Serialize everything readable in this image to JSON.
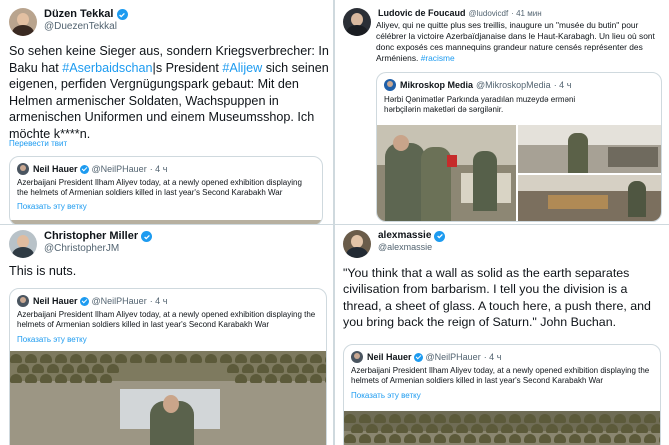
{
  "tweets": [
    {
      "name": "Düzen Tekkal",
      "handle": "@DuezenTekkal",
      "text_parts": [
        {
          "t": "So sehen keine Sieger aus, sondern Kriegsverbrecher: In Baku hat ",
          "tag": false
        },
        {
          "t": "#Aserbaidschan",
          "tag": true
        },
        {
          "t": "|s President ",
          "tag": false
        },
        {
          "t": "#Alijew",
          "tag": true
        },
        {
          "t": " sich seinen eigenen, perfiden Vergnügungspark gebaut: Mit den Helmen armenischer Soldaten, Wachspuppen in armenischen Uniformen und einem Museumsshop. Ich möchte k****n.",
          "tag": false
        }
      ],
      "translate": "Перевести твит",
      "quote": {
        "name": "Neil Hauer",
        "handle": "@NeilPHauer",
        "time": "· 4 ч",
        "text": "Azerbaijani President Ilham Aliyev today, at a newly opened exhibition displaying the helmets of Armenian soldiers killed in last year's Second Karabakh War",
        "show": "Показать эту ветку"
      }
    },
    {
      "name": "Ludovic de Foucaud",
      "handle": "@ludovicdf",
      "time": "· 41 мин",
      "text_parts": [
        {
          "t": "Aliyev, qui ne quitte plus ses treillis, inaugure un \"musée du butin\" pour célébrer la victoire Azerbaïdjanaise dans le Haut-Karabagh. Un lieu où sont donc exposés ces mannequins grandeur nature censés représenter des Arméniens. ",
          "tag": false
        },
        {
          "t": "#racisme",
          "tag": true
        }
      ],
      "quote": {
        "name": "Mikroskop Media",
        "handle": "@MikroskopMedia",
        "time": "· 4 ч",
        "text": "Hərbi Qənimətlər Parkında yaradılan muzeydə erməni hərbçilərin maketləri də sərgilənir."
      }
    },
    {
      "name": "Christopher Miller",
      "handle": "@ChristopherJM",
      "text_parts": [
        {
          "t": "This is nuts.",
          "tag": false
        }
      ],
      "quote": {
        "name": "Neil Hauer",
        "handle": "@NeilPHauer",
        "time": "· 4 ч",
        "text": "Azerbaijani President Ilham Aliyev today, at a newly opened exhibition displaying the helmets of Armenian soldiers killed in last year's Second Karabakh War",
        "show": "Показать эту ветку"
      }
    },
    {
      "name": "alexmassie",
      "handle": "@alexmassie",
      "text_parts": [
        {
          "t": "\"You think that a wall as solid as the earth separates civilisation from barbarism. I tell you the division is a thread, a sheet of glass. A touch here, a push there, and you bring back the reign of Saturn.\" John Buchan.",
          "tag": false
        }
      ],
      "quote": {
        "name": "Neil Hauer",
        "handle": "@NeilPHauer",
        "time": "· 4 ч",
        "text": "Azerbaijani President Ilham Aliyev today, at a newly opened exhibition displaying the helmets of Armenian soldiers killed in last year's Second Karabakh War",
        "show": "Показать эту ветку"
      }
    }
  ],
  "colors": {
    "link": "#1d9bf0",
    "text": "#0f1419",
    "muted": "#536471",
    "border": "#cfd9de"
  }
}
